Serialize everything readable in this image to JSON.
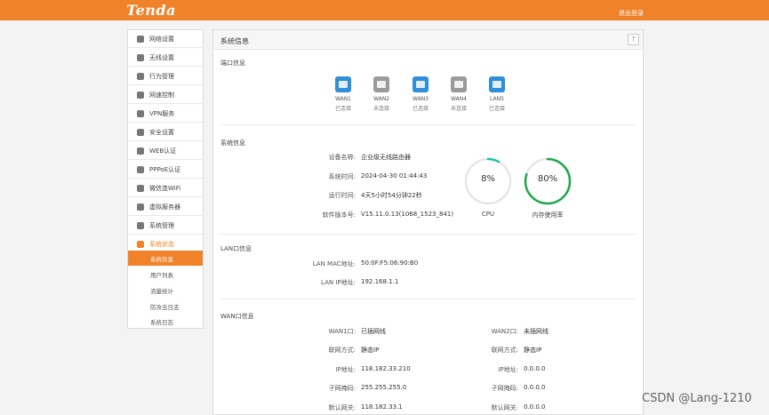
{
  "header": {
    "logo": "Tenda",
    "logout": "退出登录"
  },
  "sidebar": {
    "items": [
      {
        "label": "网络设置",
        "icon": "globe-icon"
      },
      {
        "label": "无线设置",
        "icon": "wifi-icon"
      },
      {
        "label": "行为管理",
        "icon": "user-icon"
      },
      {
        "label": "网速控制",
        "icon": "speed-icon"
      },
      {
        "label": "VPN服务",
        "icon": "vpn-icon"
      },
      {
        "label": "安全设置",
        "icon": "shield-icon"
      },
      {
        "label": "WEB认证",
        "icon": "web-icon"
      },
      {
        "label": "PPPoE认证",
        "icon": "pppoe-icon"
      },
      {
        "label": "微信连WiFi",
        "icon": "wechat-icon"
      },
      {
        "label": "虚拟服务器",
        "icon": "server-icon"
      },
      {
        "label": "系统管理",
        "icon": "gear-icon"
      },
      {
        "label": "系统状态",
        "icon": "pulse-icon"
      }
    ],
    "subitems": [
      "系统信息",
      "用户列表",
      "流量统计",
      "防攻击日志",
      "系统日志"
    ]
  },
  "main": {
    "title": "系统信息",
    "help": "?",
    "port_section": "端口信息",
    "ports": [
      {
        "name": "WAN1",
        "status": "已连接",
        "up": true
      },
      {
        "name": "WAN2",
        "status": "未连接",
        "up": false
      },
      {
        "name": "WAN3",
        "status": "已连接",
        "up": true
      },
      {
        "name": "WAN4",
        "status": "未连接",
        "up": false
      },
      {
        "name": "LAN5",
        "status": "已连接",
        "up": true
      }
    ],
    "sys_section": "系统信息",
    "sys": {
      "device_label": "设备名称:",
      "device_value": "企业级无线路由器",
      "time_label": "系统时间:",
      "time_value": "2024-04-30 01:44:43",
      "uptime_label": "运行时间:",
      "uptime_value": "4天5小时54分钟22秒",
      "version_label": "软件版本号:",
      "version_value": "V15.11.0.13(1068_1523_841)"
    },
    "cpu": {
      "value": "8%",
      "label": "CPU",
      "percent": 8,
      "color": "#19c4b3"
    },
    "mem": {
      "value": "80%",
      "label": "内存使用率",
      "percent": 80,
      "color": "#1ea84a"
    },
    "lan_section": "LAN口信息",
    "lan": {
      "mac_label": "LAN MAC地址:",
      "mac_value": "50:0F:F5:06:90:B0",
      "ip_label": "LAN IP地址:",
      "ip_value": "192.168.1.1"
    },
    "wan_section": "WAN口信息",
    "wan1": {
      "port_label": "WAN1口:",
      "port_value": "已插网线",
      "mode_label": "联网方式:",
      "mode_value": "静态IP",
      "ip_label": "IP地址:",
      "ip_value": "118.182.33.210",
      "mask_label": "子网掩码:",
      "mask_value": "255.255.255.0",
      "gw_label": "默认网关:",
      "gw_value": "118.182.33.1"
    },
    "wan2": {
      "port_label": "WAN2口:",
      "port_value": "未插网线",
      "mode_label": "联网方式:",
      "mode_value": "静态IP",
      "ip_label": "IP地址:",
      "ip_value": "0.0.0.0",
      "mask_label": "子网掩码:",
      "mask_value": "0.0.0.0",
      "gw_label": "默认网关:",
      "gw_value": "0.0.0.0"
    }
  },
  "watermark": "CSDN @Lang-1210",
  "colors": {
    "brand": "#f08229",
    "port_up": "#2f8fd8",
    "port_down": "#9a9a9a"
  }
}
